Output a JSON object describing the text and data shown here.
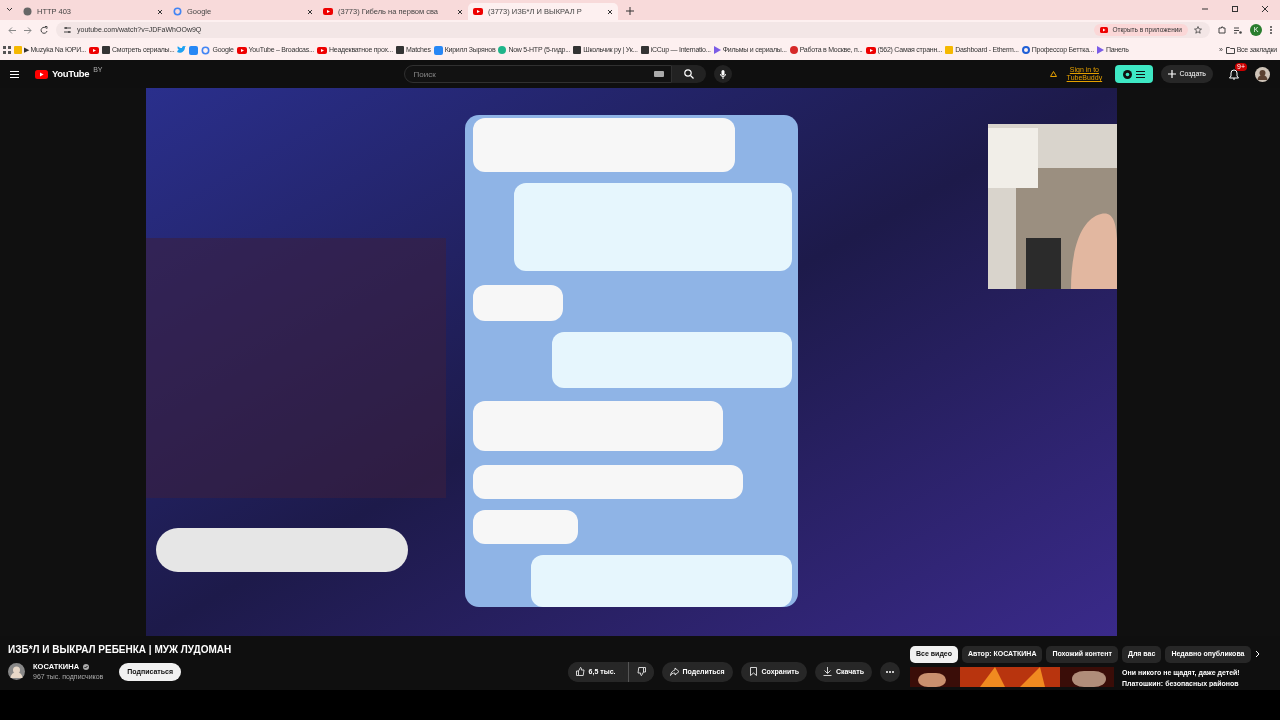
{
  "browser": {
    "tabs": [
      {
        "title": "HTTP 403",
        "kind": "globe",
        "selected": false
      },
      {
        "title": "Google",
        "kind": "google",
        "selected": false
      },
      {
        "title": "(3773) Гибель на первом сва",
        "kind": "youtube",
        "selected": false
      },
      {
        "title": "(3773) ИЗБ*Л И ВЫКРАЛ Р",
        "kind": "youtube",
        "selected": true
      }
    ],
    "address": "youtube.com/watch?v=JDFaWhOOw9Q",
    "open_in_app": "Открыть в приложении",
    "profile_initial": "K",
    "bookmarks": [
      {
        "label": "▶ Muzyka Na ЮРИ...",
        "kind": "yellow"
      },
      {
        "kind": "youtube"
      },
      {
        "label": "Смотреть сериалы...",
        "kind": "dark"
      },
      {
        "kind": "twitter"
      },
      {
        "kind": "vk"
      },
      {
        "label": "Google",
        "kind": "google"
      },
      {
        "label": "YouTube – Broadcas...",
        "kind": "youtube"
      },
      {
        "label": "Неадекватное прох...",
        "kind": "youtube"
      },
      {
        "label": "Matches",
        "kind": "dark"
      },
      {
        "label": "Кирилл Зырянов",
        "kind": "vk"
      },
      {
        "label": "Now 5-HTP (5-гидр...",
        "kind": "green"
      },
      {
        "label": "Школьчик ру | Ук...",
        "kind": "dark"
      },
      {
        "label": "iCCup — Internatio...",
        "kind": "dark"
      },
      {
        "label": "Фильмы и сериалы...",
        "kind": "purple"
      },
      {
        "label": "Работа в Москве, п...",
        "kind": "red"
      },
      {
        "label": "(562) Самая странн...",
        "kind": "youtube"
      },
      {
        "label": "Dashboard - Etherm...",
        "kind": "yellow"
      },
      {
        "label": "Профессор Беттка...",
        "kind": "blue"
      },
      {
        "label": "Панель",
        "kind": "purple"
      }
    ],
    "bookmarks_more": "»",
    "all_bookmarks": "Все закладки"
  },
  "youtube": {
    "logo": "YouTube",
    "region": "BY",
    "search": {
      "placeholder": "Поиск"
    },
    "tubebuddy": "Sign in to TubeBuddy",
    "create": "Создать",
    "notifications": "9+",
    "title": "ИЗБ*Л И ВЫКРАЛ РЕБЕНКА | МУЖ ЛУДОМАН",
    "channel": {
      "name": "КОСАТКИНА",
      "verified": true,
      "subscribers": "967 тыс. подписчиков"
    },
    "subscribe": "Подписаться",
    "likes": "6,5 тыс.",
    "actions": [
      {
        "label": "Поделиться",
        "kind": "share"
      },
      {
        "label": "Сохранить",
        "kind": "save"
      },
      {
        "label": "Скачать",
        "kind": "download"
      }
    ],
    "chips": [
      {
        "label": "Все видео",
        "selected": true
      },
      {
        "label": "Автор: КОСАТКИНА",
        "selected": false
      },
      {
        "label": "Похожий контент",
        "selected": false
      },
      {
        "label": "Для вас",
        "selected": false
      },
      {
        "label": "Недавно опубликова",
        "selected": false
      }
    ],
    "recommended": [
      {
        "title": "Они никого не щадят, даже детей! Платошкин: безопасных районов"
      }
    ]
  }
}
